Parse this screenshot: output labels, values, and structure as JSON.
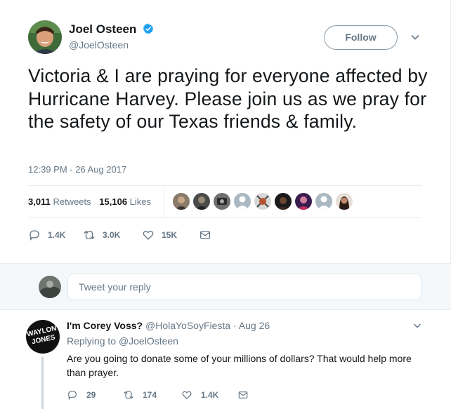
{
  "tweet": {
    "author_name": "Joel Osteen",
    "author_handle": "@JoelOsteen",
    "follow_label": "Follow",
    "text": "Victoria & I are praying for everyone affected by Hurricane Harvey. Please join us as we pray for the safety of our Texas friends & family.",
    "timestamp": "12:39 PM - 26 Aug 2017",
    "retweets_count": "3,011",
    "retweets_label": "Retweets",
    "likes_count": "15,106",
    "likes_label": "Likes",
    "actions": {
      "replies": "1.4K",
      "retweets": "3.0K",
      "likes": "15K"
    },
    "liker_avatar_count_shown": 9
  },
  "reply_box": {
    "placeholder": "Tweet your reply"
  },
  "reply": {
    "author_name": "I'm Corey Voss?",
    "author_handle": "@HolaYoSoyFiesta",
    "separator": "·",
    "date": "Aug 26",
    "replying_prefix": "Replying to",
    "replying_to": "@JoelOsteen",
    "text": "Are you going to donate some of your millions of dollars? That would help more than prayer.",
    "actions": {
      "replies": "29",
      "retweets": "174",
      "likes": "1.4K"
    },
    "avatar_text": "WAYLON JONES"
  },
  "colors": {
    "accent_blue": "#1da1f2",
    "text_primary": "#14171a",
    "text_secondary": "#657786",
    "border": "#e6ecf0",
    "reply_area_bg": "#f5f8fa"
  }
}
